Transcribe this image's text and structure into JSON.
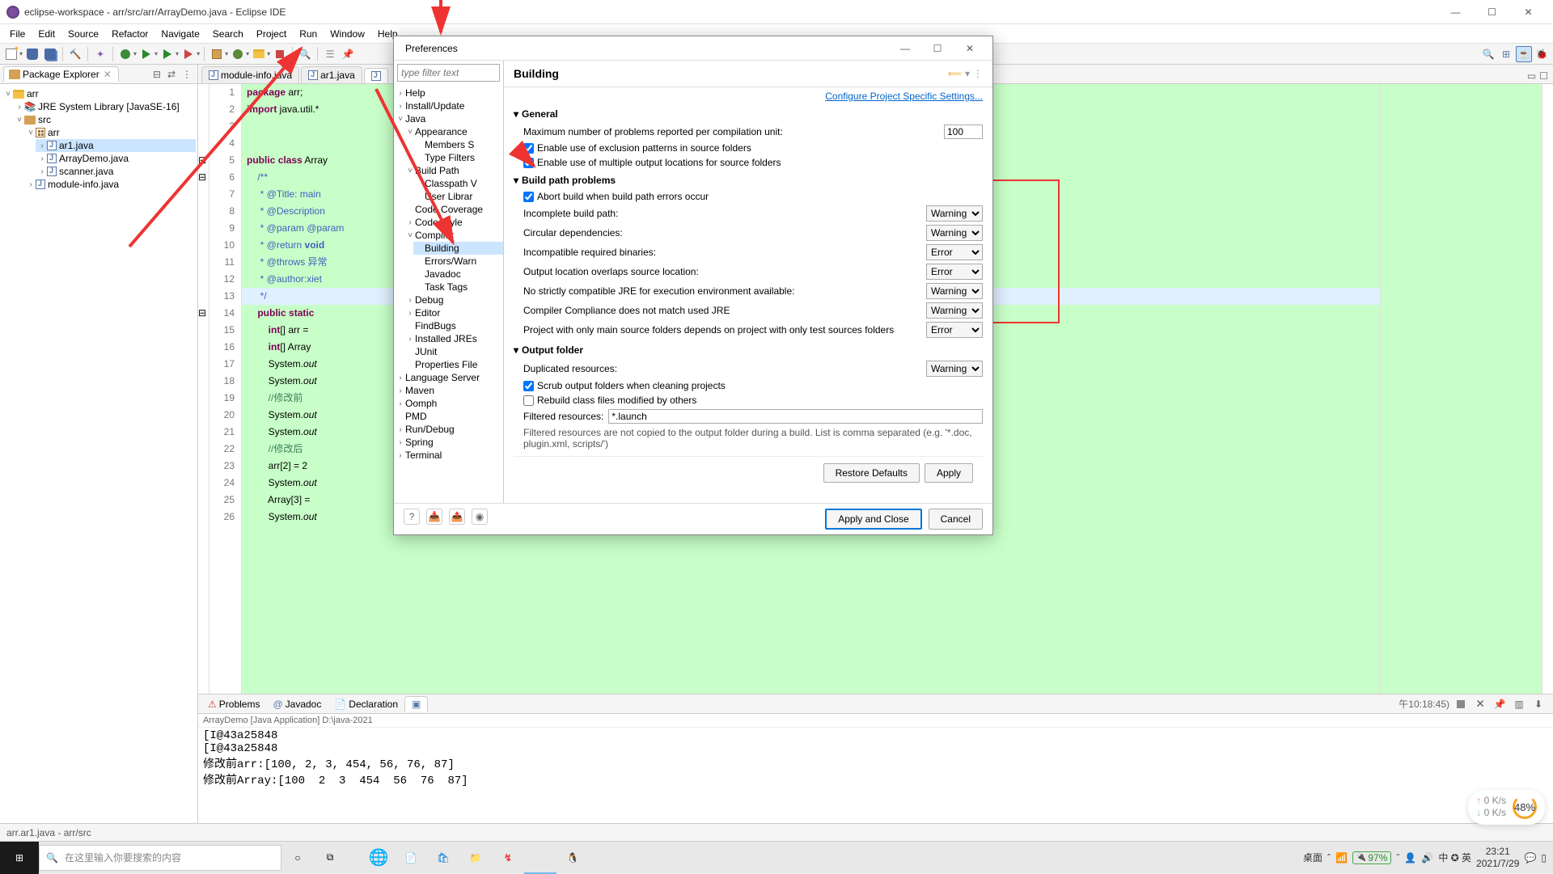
{
  "window": {
    "title": "eclipse-workspace - arr/src/arr/ArrayDemo.java - Eclipse IDE"
  },
  "menu": [
    "File",
    "Edit",
    "Source",
    "Refactor",
    "Navigate",
    "Search",
    "Project",
    "Run",
    "Window",
    "Help"
  ],
  "pkg_explorer": {
    "title": "Package Explorer",
    "project": "arr",
    "jre": "JRE System Library [JavaSE-16]",
    "src": "src",
    "pkg": "arr",
    "files": [
      "ar1.java",
      "ArrayDemo.java",
      "scanner.java"
    ],
    "module": "module-info.java"
  },
  "editor": {
    "tabs": [
      "module-info.java",
      "ar1.java"
    ],
    "lines": [
      {
        "n": 1,
        "html": "<span class='kw'>package</span> arr;"
      },
      {
        "n": 2,
        "html": "<span class='kw'>import</span> java.util.*"
      },
      {
        "n": 3,
        "html": ""
      },
      {
        "n": 4,
        "html": ""
      },
      {
        "n": 5,
        "html": "<span class='kw'>public</span> <span class='kw'>class</span> Array"
      },
      {
        "n": 6,
        "html": "    <span class='com'>/**</span>"
      },
      {
        "n": 7,
        "html": "    <span class='com'> * @Title: main</span>"
      },
      {
        "n": 8,
        "html": "    <span class='com'> * @Description</span>"
      },
      {
        "n": 9,
        "html": "    <span class='com'> * @param @param</span>"
      },
      {
        "n": 10,
        "html": "    <span class='com'> * @return <b>void</b></span>"
      },
      {
        "n": 11,
        "html": "    <span class='com'> * @throws 异常</span>"
      },
      {
        "n": 12,
        "html": "    <span class='com'> * @author:xiet</span>"
      },
      {
        "n": 13,
        "html": "    <span class='com'> */</span>"
      },
      {
        "n": 14,
        "html": "    <span class='kw'>public</span> <span class='kw'>static</span> "
      },
      {
        "n": 15,
        "html": "        <span class='kw'>int</span>[] arr ="
      },
      {
        "n": 16,
        "html": "        <span class='kw'>int</span>[] Array"
      },
      {
        "n": 17,
        "html": "        System.<i>out</i>"
      },
      {
        "n": 18,
        "html": "        System.<i>out</i>"
      },
      {
        "n": 19,
        "html": "        <span class='comg'>//修改前</span>"
      },
      {
        "n": 20,
        "html": "        System.<i>out</i>"
      },
      {
        "n": 21,
        "html": "        System.<i>out</i>"
      },
      {
        "n": 22,
        "html": "        <span class='comg'>//修改后</span>"
      },
      {
        "n": 23,
        "html": "        arr[2] = 2"
      },
      {
        "n": 24,
        "html": "        System.<i>out</i>"
      },
      {
        "n": 25,
        "html": "        Array[3] ="
      },
      {
        "n": 26,
        "html": "        System.<i>out</i>"
      }
    ]
  },
  "bottom": {
    "tabs": [
      "Problems",
      "Javadoc",
      "Declaration"
    ],
    "console_header": "ArrayDemo [Java Application] D:\\java-2021",
    "console_tail": "午10:18:45)",
    "output": "[I@43a25848\n[I@43a25848\n修改前arr:[100, 2, 3, 454, 56, 76, 87]\n修改前Array:[100  2  3  454  56  76  87]"
  },
  "status": "arr.ar1.java - arr/src",
  "prefs": {
    "title": "Preferences",
    "filter_placeholder": "type filter text",
    "nav": {
      "top": [
        "Help",
        "Install/Update"
      ],
      "java": "Java",
      "java_children": [
        "Appearance",
        "Build Path",
        "Code Coverage",
        "Code Style",
        "Compiler",
        "Debug",
        "Editor",
        "FindBugs",
        "Installed JREs",
        "JUnit",
        "Properties File"
      ],
      "appearance_children": [
        "Members S",
        "Type Filters"
      ],
      "buildpath_children": [
        "Classpath V",
        "User Librar"
      ],
      "compiler_children": [
        "Building",
        "Errors/Warn",
        "Javadoc",
        "Task Tags"
      ],
      "bottom": [
        "Language Server",
        "Maven",
        "Oomph",
        "PMD",
        "Run/Debug",
        "Spring",
        "Terminal"
      ]
    },
    "page_title": "Building",
    "config_link": "Configure Project Specific Settings...",
    "general": {
      "title": "General",
      "max_problems_label": "Maximum number of problems reported per compilation unit:",
      "max_problems": "100",
      "exclusion": "Enable use of exclusion patterns in source folders",
      "multiple_output": "Enable use of multiple output locations for source folders"
    },
    "bpp": {
      "title": "Build path problems",
      "abort": "Abort build when build path errors occur",
      "rows": [
        {
          "label": "Incomplete build path:",
          "val": "Warning"
        },
        {
          "label": "Circular dependencies:",
          "val": "Warning"
        },
        {
          "label": "Incompatible required binaries:",
          "val": "Error"
        },
        {
          "label": "Output location overlaps source location:",
          "val": "Error"
        },
        {
          "label": "No strictly compatible JRE for execution environment available:",
          "val": "Warning"
        },
        {
          "label": "Compiler Compliance does not match used JRE",
          "val": "Warning"
        },
        {
          "label": "Project with only main source folders depends on project with only test sources folders",
          "val": "Error"
        }
      ]
    },
    "output": {
      "title": "Output folder",
      "dup_label": "Duplicated resources:",
      "dup_val": "Warning",
      "scrub": "Scrub output folders when cleaning projects",
      "rebuild": "Rebuild class files modified by others",
      "filtered_label": "Filtered resources:",
      "filtered_val": "*.launch",
      "filtered_hint": "Filtered resources are not copied to the output folder during a build. List is comma separated (e.g. '*.doc, plugin.xml, scripts/')"
    },
    "restore": "Restore Defaults",
    "apply": "Apply",
    "apply_close": "Apply and Close",
    "cancel": "Cancel"
  },
  "taskbar": {
    "search_placeholder": "在这里输入你要搜索的内容",
    "desktop": "桌面",
    "battery": "97%",
    "ime": "中 ✪ 英",
    "speaker_icon": "🔊",
    "time": "23:21",
    "date": "2021/7/29"
  },
  "speed": {
    "up": "0  K/s",
    "down": "0  K/s",
    "pct": "48%"
  }
}
